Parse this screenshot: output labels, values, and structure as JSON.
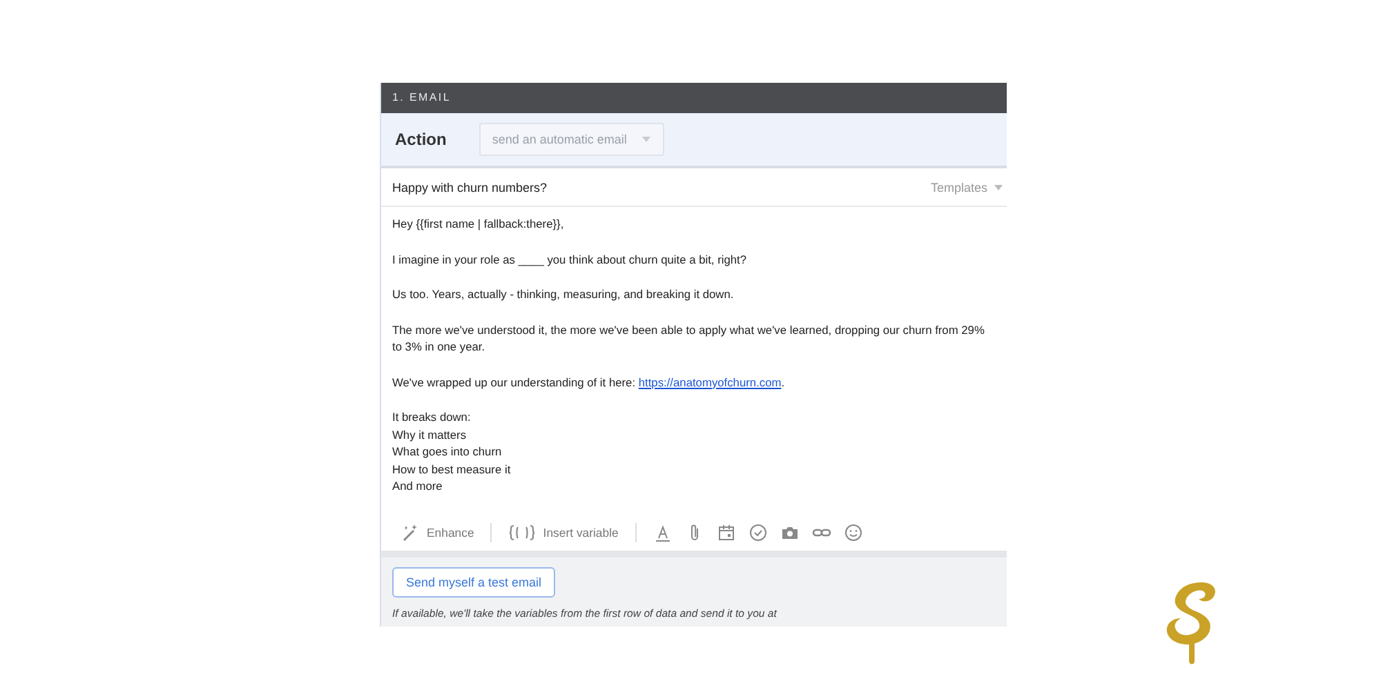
{
  "panel": {
    "step_title": "1. EMAIL",
    "action": {
      "label": "Action",
      "dropdown": {
        "value": "send an automatic email",
        "disabled": true
      }
    },
    "subject": {
      "value": "Happy with churn numbers?",
      "templates": "Templates"
    },
    "body": [
      {
        "kind": "text",
        "lines": [
          "Hey {{first name | fallback:there}},"
        ]
      },
      {
        "kind": "text",
        "lines": [
          "I imagine in your role as ____ you think about churn quite a bit, right?"
        ]
      },
      {
        "kind": "text",
        "lines": [
          "Us too. Years, actually - thinking, measuring, and breaking it down."
        ]
      },
      {
        "kind": "text",
        "lines": [
          "The more we've understood it, the more we've been able to apply what we've learned, dropping our churn from 29% to 3% in one year."
        ]
      },
      {
        "kind": "link",
        "text": "We've wrapped up our understanding of it here:",
        "link": "https://anatomyofchurn.com",
        "after": "."
      },
      {
        "kind": "text",
        "lines": [
          "It breaks down:",
          "Why it matters",
          "What goes into churn",
          "How to best measure it",
          "And more"
        ]
      }
    ],
    "toolbar": {
      "enhance": "Enhance",
      "insert_variable": "Insert variable"
    },
    "test_button": "Send myself a test email",
    "note": "If available, we'll take the variables from the first row of data and send it to you at"
  }
}
